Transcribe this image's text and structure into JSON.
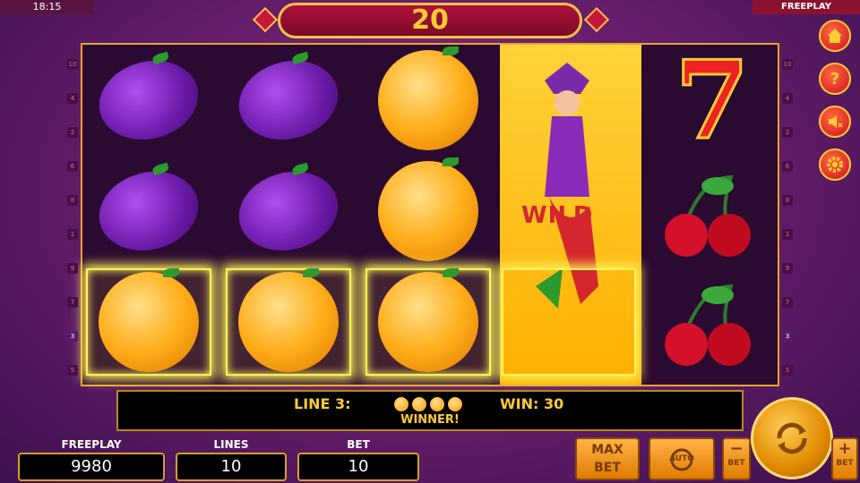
{
  "status_bar": {
    "time": "18:15",
    "mode": "FREEPLAY"
  },
  "win_banner": {
    "amount": "20"
  },
  "reels": {
    "reel1": [
      "plum",
      "plum",
      "orange"
    ],
    "reel2": [
      "plum",
      "plum",
      "orange"
    ],
    "reel3": [
      "orange",
      "orange",
      "orange"
    ],
    "reel4": [
      "wild-joker"
    ],
    "reel5": [
      "seven",
      "cherry",
      "cherry"
    ],
    "wild_label": "WILD"
  },
  "line_numbers_left": [
    "10",
    "4",
    "2",
    "6",
    "8",
    "1",
    "9",
    "7",
    "3",
    "5"
  ],
  "line_numbers_right": [
    "10",
    "4",
    "2",
    "6",
    "8",
    "1",
    "9",
    "7",
    "3",
    "5"
  ],
  "active_line": "3",
  "message": {
    "line": "LINE 3:",
    "win": "WIN: 30",
    "status": "WINNER!"
  },
  "stats": {
    "freeplay_label": "FREEPLAY",
    "freeplay_value": "9980",
    "lines_label": "LINES",
    "lines_value": "10",
    "bet_label": "BET",
    "bet_value": "10"
  },
  "controls": {
    "max_bet_top": "MAX",
    "max_bet_bottom": "BET",
    "auto": "AUTO",
    "bet_minus_label": "BET",
    "bet_plus_label": "BET",
    "minus": "−",
    "plus": "+"
  },
  "side_menu": {
    "help": "?"
  },
  "colors": {
    "accent_gold": "#ffcc33",
    "highlight": "#fff35a",
    "banner_red": "#b0113a"
  }
}
